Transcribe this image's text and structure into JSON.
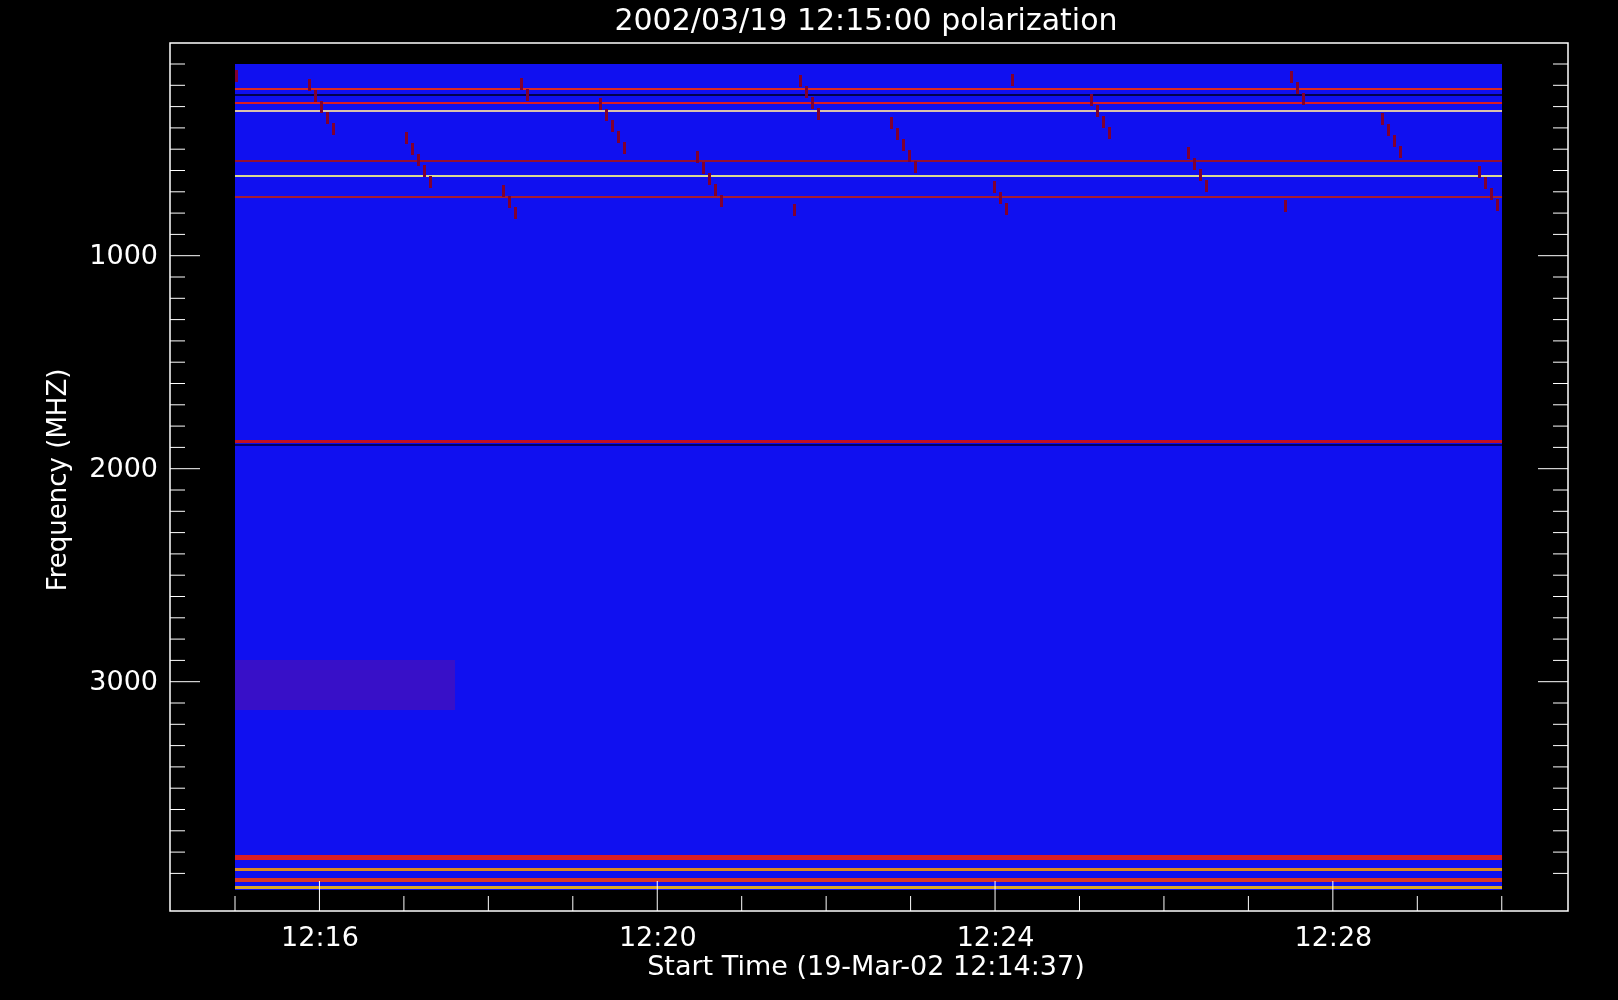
{
  "title": "2002/03/19 12:15:00 polarization",
  "y_axis": {
    "label": "Frequency (MHZ)",
    "ticks": [
      "1000",
      "2000",
      "3000"
    ]
  },
  "x_axis": {
    "label": "Start Time (19-Mar-02 12:14:37)",
    "ticks": [
      "12:16",
      "12:20",
      "12:24",
      "12:28"
    ]
  }
}
